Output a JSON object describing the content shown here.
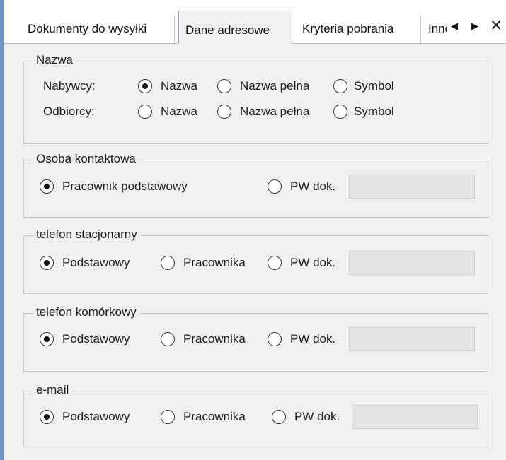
{
  "tabs": [
    {
      "label": "Dokumenty do wysyłki",
      "selected": false
    },
    {
      "label": "Dane adresowe",
      "selected": true
    },
    {
      "label": "Kryteria pobrania",
      "selected": false
    },
    {
      "label": "Inne",
      "selected": false
    }
  ],
  "tab_nav": {
    "prev_icon": "triangle-left-icon",
    "next_icon": "triangle-right-icon",
    "close_icon": "close-icon"
  },
  "nazwa": {
    "legend": "Nazwa",
    "rows": [
      {
        "label": "Nabywcy:",
        "options": [
          "Nazwa",
          "Nazwa pełna",
          "Symbol"
        ],
        "selected": "Nazwa"
      },
      {
        "label": "Odbiorcy:",
        "options": [
          "Nazwa",
          "Nazwa pełna",
          "Symbol"
        ],
        "selected": ""
      }
    ]
  },
  "osoba": {
    "legend": "Osoba kontaktowa",
    "options": [
      "Pracownik podstawowy",
      "PW dok."
    ],
    "selected": "Pracownik podstawowy",
    "field_value": ""
  },
  "telefon_stacjonarny": {
    "legend": "telefon stacjonarny",
    "options": [
      "Podstawowy",
      "Pracownika",
      "PW dok."
    ],
    "selected": "Podstawowy",
    "field_value": ""
  },
  "telefon_komorkowy": {
    "legend": "telefon komórkowy",
    "options": [
      "Podstawowy",
      "Pracownika",
      "PW dok."
    ],
    "selected": "Podstawowy",
    "field_value": ""
  },
  "email": {
    "legend": "e-mail",
    "options": [
      "Podstawowy",
      "Pracownika",
      "PW dok."
    ],
    "selected": "Podstawowy",
    "field_value": ""
  },
  "colors": {
    "accent_border": "#6f93c4",
    "panel_bg": "#f0f0f0",
    "group_border": "#c7c7c7",
    "field_bg": "#e4e4e4"
  }
}
